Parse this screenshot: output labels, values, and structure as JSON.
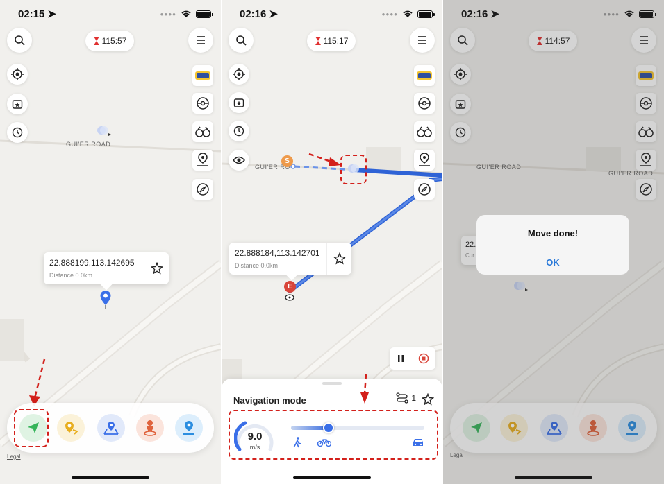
{
  "panel1": {
    "time": "02:15",
    "timer": "115:57",
    "road": "GUI'ER ROAD",
    "coord": "22.888199,113.142695",
    "distance": "Distance 0.0km",
    "legal": "Legal"
  },
  "panel2": {
    "time": "02:16",
    "timer": "115:17",
    "road": "GUI'ER RO",
    "start_marker": "S",
    "end_marker": "E",
    "coord": "22.888184,113.142701",
    "distance": "Distance 0.0km",
    "nav_title": "Navigation mode",
    "route_count": "1",
    "speed_value": "9.0",
    "speed_unit": "m/s",
    "speed_fraction": 0.28
  },
  "panel3": {
    "time": "02:16",
    "timer": "114:57",
    "road_left": "GUI'ER ROAD",
    "road_right": "GUI'ER ROAD",
    "coord_fragment": "22.",
    "coord_sub_fragment": "Cur",
    "alert_title": "Move done!",
    "alert_ok": "OK",
    "legal": "Legal"
  },
  "colors": {
    "accent_blue": "#3a6fe8",
    "route_blue": "#2f63d6",
    "alert_red": "#d3201b",
    "map_bg": "#f1f0ed"
  },
  "icons": [
    "search-icon",
    "menu-icon",
    "hourglass-icon",
    "locate-icon",
    "favorites-icon",
    "history-icon",
    "pokemon-go-icon",
    "pokeball-icon",
    "binoculars-icon",
    "route-pin-icon",
    "compass-icon",
    "eye-icon",
    "teleport-icon",
    "jump-icon",
    "multi-stop-icon",
    "joystick-icon",
    "one-stop-icon"
  ]
}
